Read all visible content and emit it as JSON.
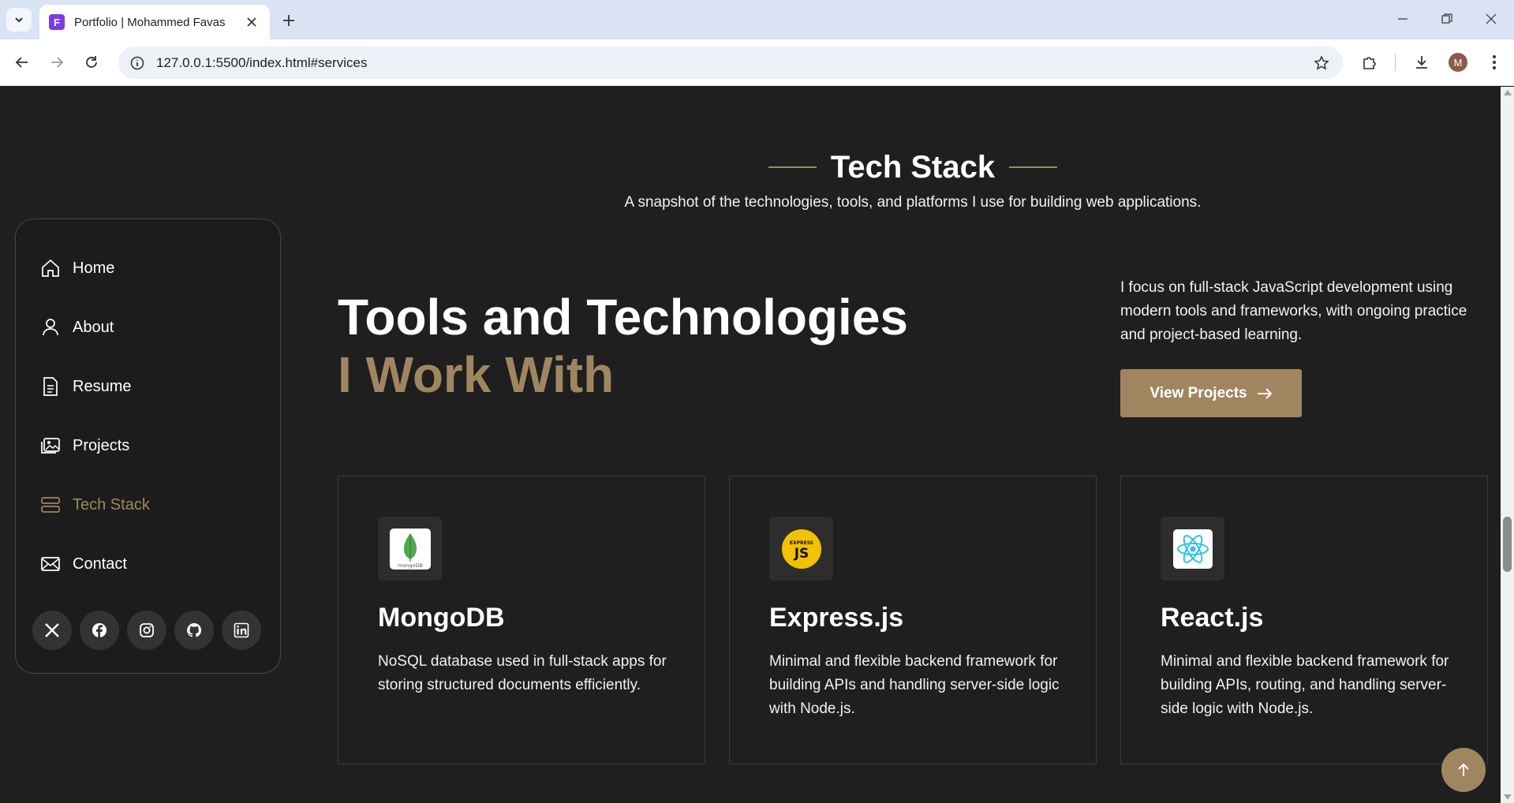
{
  "browser": {
    "tab_title": "Portfolio | Mohammed Favas",
    "tab_favicon_letter": "F",
    "url": "127.0.0.1:5500/index.html#services",
    "profile_initial": "M"
  },
  "section": {
    "title": "Tech Stack",
    "subtitle": "A snapshot of the technologies, tools, and platforms I use for building web applications."
  },
  "sidebar": {
    "items": [
      {
        "label": "Home",
        "icon": "home-icon",
        "active": false
      },
      {
        "label": "About",
        "icon": "user-icon",
        "active": false
      },
      {
        "label": "Resume",
        "icon": "document-icon",
        "active": false
      },
      {
        "label": "Projects",
        "icon": "image-icon",
        "active": false
      },
      {
        "label": "Tech Stack",
        "icon": "server-icon",
        "active": true
      },
      {
        "label": "Contact",
        "icon": "mail-icon",
        "active": false
      }
    ],
    "socials": [
      "x-icon",
      "facebook-icon",
      "instagram-icon",
      "github-icon",
      "linkedin-icon"
    ]
  },
  "heading": {
    "line1": "Tools and Technologies",
    "line2": "I Work With"
  },
  "intro": {
    "text": "I focus on full-stack JavaScript development using modern tools and frameworks, with ongoing practice and project-based learning.",
    "button_label": "View Projects"
  },
  "cards": [
    {
      "title": "MongoDB",
      "desc": "NoSQL database used in full-stack apps for storing structured documents efficiently.",
      "icon": "mongodb-logo-icon",
      "logo_text": "mongoDB"
    },
    {
      "title": "Express.js",
      "desc": "Minimal and flexible backend framework for building APIs and handling server-side logic with Node.js.",
      "icon": "expressjs-logo-icon",
      "logo_text": "EXPRESS JS"
    },
    {
      "title": "React.js",
      "desc": "Minimal and flexible backend framework for building APIs, routing, and handling server-side logic with Node.js.",
      "icon": "react-logo-icon",
      "logo_text": ""
    }
  ],
  "colors": {
    "accent": "#a08660",
    "background": "#1f1f1f",
    "text": "#ffffff"
  }
}
